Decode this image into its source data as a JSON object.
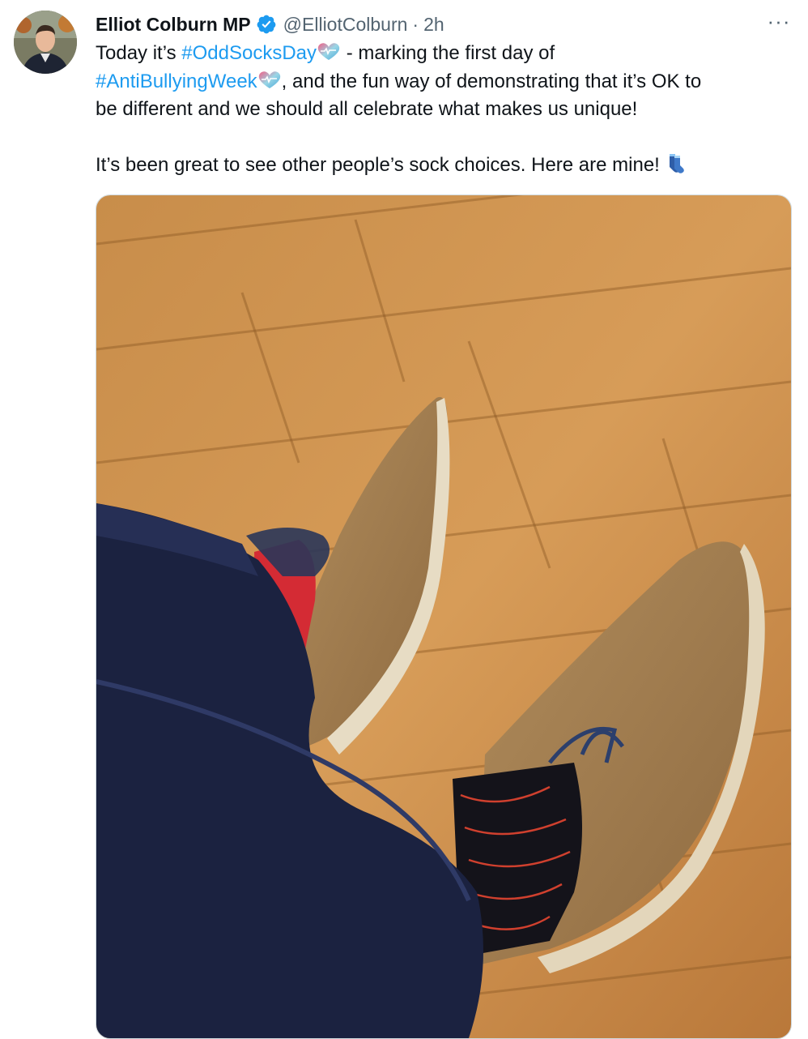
{
  "tweet": {
    "author_name": "Elliot Colburn MP",
    "handle": "@ElliotColburn",
    "separator": "·",
    "time": "2h",
    "more_label": "···",
    "text": {
      "line1_a": "Today it’s ",
      "hashtag1": "#OddSocksDay",
      "line1_b": " - marking the first day of",
      "hashtag2": "#AntiBullyingWeek",
      "line2_b": ", and the fun way of demonstrating that it’s OK to",
      "line3": "be different and we should all celebrate what makes us unique!",
      "line4": "It’s been great to see other people’s sock choices. Here are mine!"
    },
    "hashtag_color": "#1d9bf0",
    "emojis": [
      "heart-emoji",
      "heart-emoji",
      "socks-emoji"
    ]
  },
  "icons": [
    "verified-badge-icon",
    "more-options-icon"
  ]
}
